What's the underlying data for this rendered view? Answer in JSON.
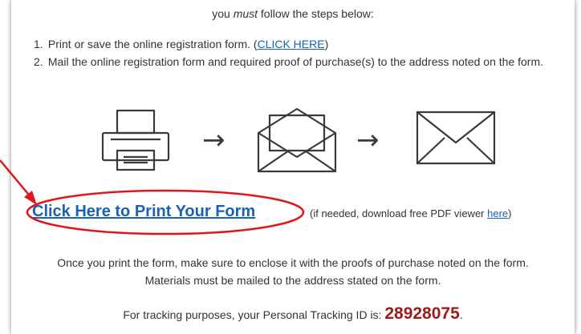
{
  "intro": {
    "prefix": "you ",
    "emphasis": "must",
    "suffix": " follow the steps below:"
  },
  "steps": [
    {
      "num": "1.",
      "text": "Print or save the online registration form. (",
      "link": "CLICK HERE",
      "after": ")"
    },
    {
      "num": "2.",
      "text": "Mail the online registration form and required proof of purchase(s) to the address noted on the form."
    }
  ],
  "icons": [
    "printer-icon",
    "open-envelope-icon",
    "closed-envelope-icon"
  ],
  "arrow_glyph": "→",
  "print_link": "Click Here to Print Your Form",
  "pdf_note": {
    "prefix": "(if needed, download free PDF viewer ",
    "link": "here",
    "suffix": ")"
  },
  "note": {
    "line1": "Once you print the form, make sure to enclose it with the proofs of purchase noted on the form.",
    "line2": "Materials must be mailed to the address stated on the form."
  },
  "tracking": {
    "label": "For tracking purposes, your Personal Tracking ID is: ",
    "id": "28928075",
    "suffix": "."
  },
  "colors": {
    "link": "#1a62b3",
    "tracking_id": "#9b1b1b",
    "annotation": "#e0161c"
  }
}
